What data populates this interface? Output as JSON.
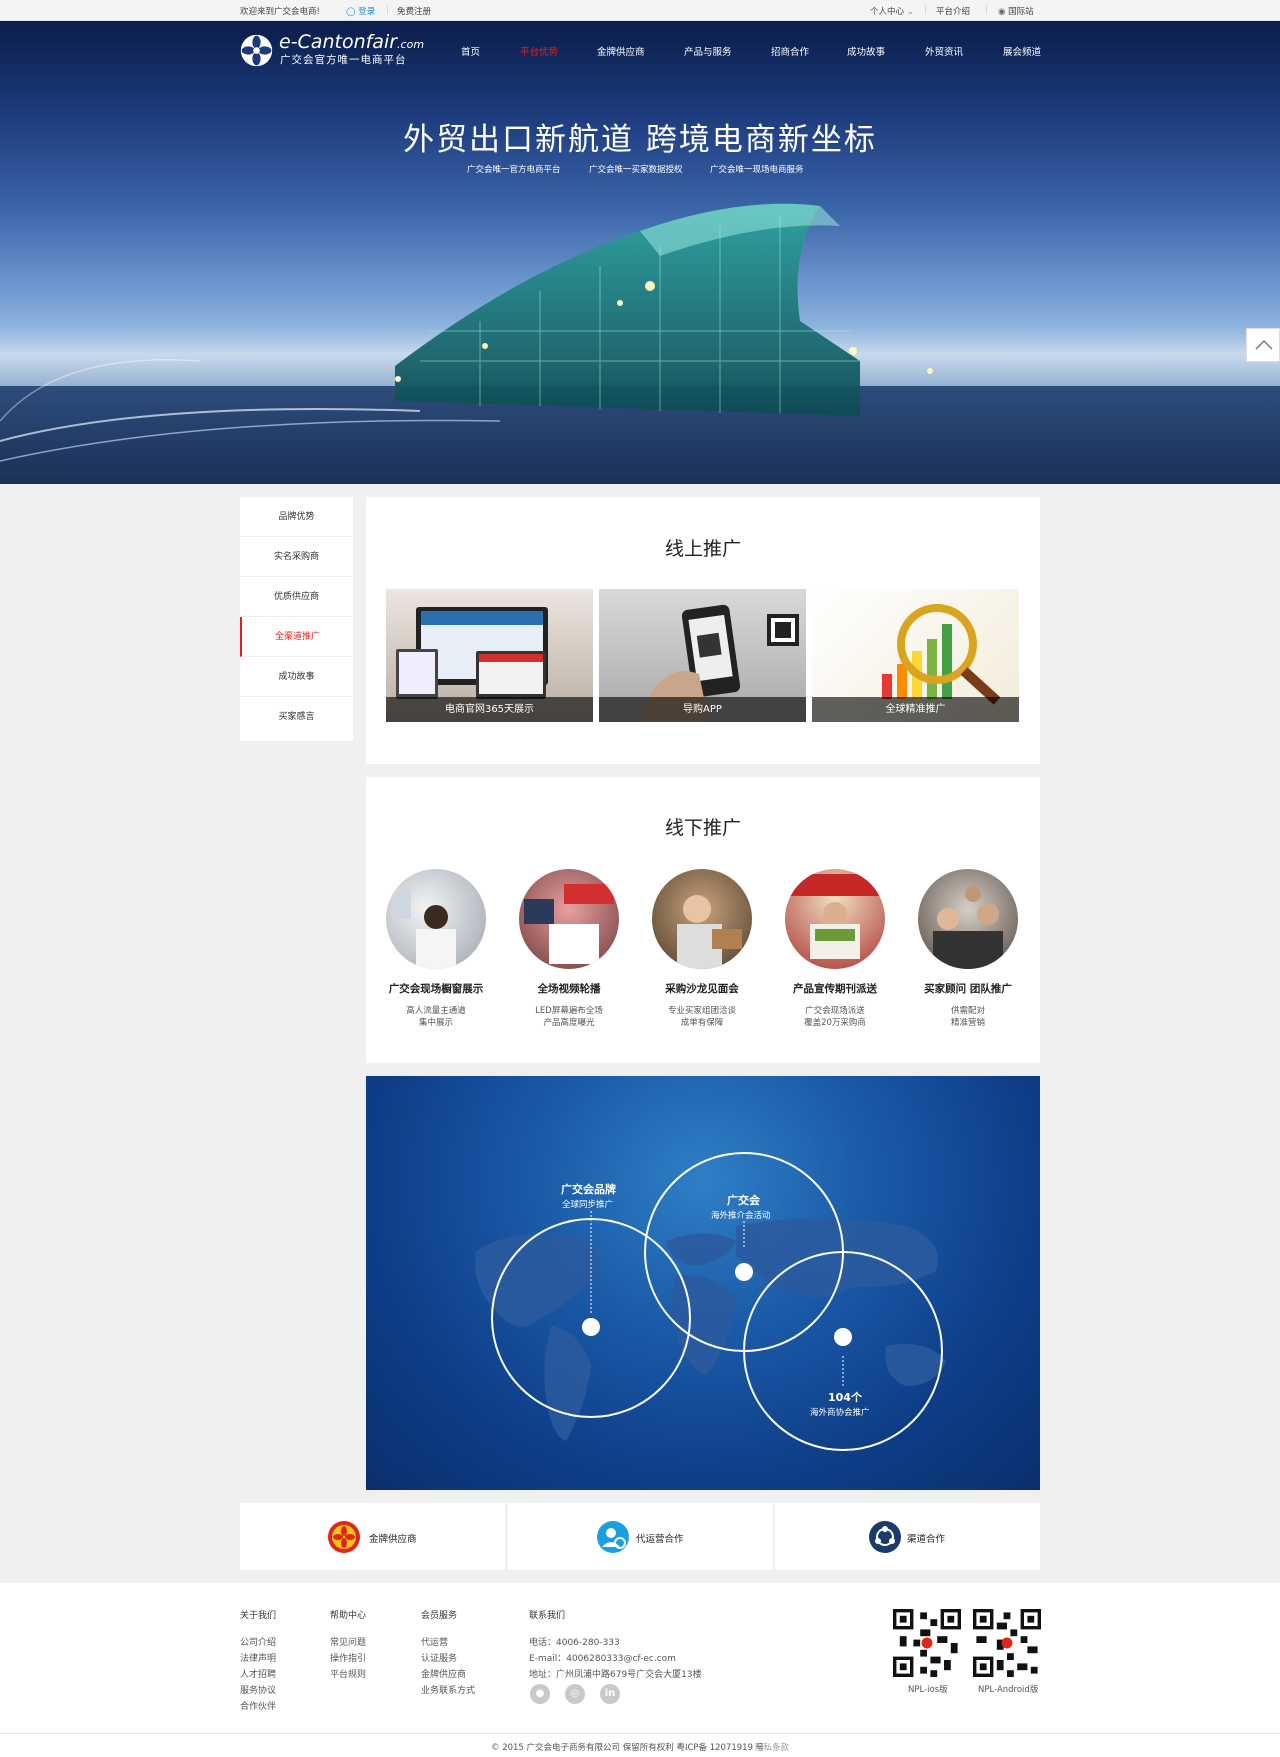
{
  "topbar": {
    "welcome": "欢迎来到广交会电商!",
    "login": "登录",
    "register": "免费注册",
    "user_center": "个人中心",
    "platform_intro": "平台介绍",
    "international": "国际站"
  },
  "header": {
    "logo_text": "e-Cantonfair",
    "logo_domain": ".com",
    "logo_sub": "广交会官方唯一电商平台",
    "nav": [
      "首页",
      "平台优势",
      "金牌供应商",
      "产品与服务",
      "招商合作",
      "成功故事",
      "外贸资讯",
      "展会频道"
    ],
    "active_nav": "平台优势"
  },
  "hero": {
    "title": "外贸出口新航道  跨境电商新坐标",
    "subs": [
      "广交会唯一官方电商平台",
      "广交会唯一买家数据授权",
      "广交会唯一现场电商服务"
    ]
  },
  "sidebar": {
    "items": [
      "品牌优势",
      "实名采购商",
      "优质供应商",
      "全渠道推广",
      "成功故事",
      "买家感言"
    ],
    "active": "全渠道推广"
  },
  "online": {
    "title": "线上推广",
    "cards": [
      "电商官网365天展示",
      "导购APP",
      "全球精准推广"
    ]
  },
  "offline": {
    "title": "线下推广",
    "items": [
      {
        "title": "广交会现场橱窗展示",
        "d1": "高人流量主通道",
        "d2": "集中展示"
      },
      {
        "title": "全场视频轮播",
        "d1": "LED屏幕遍布全场",
        "d2": "产品高度曝光"
      },
      {
        "title": "采购沙龙见面会",
        "d1": "专业买家组团洽谈",
        "d2": "成单有保障"
      },
      {
        "title": "产品宣传期刊派送",
        "d1": "广交会现场派送",
        "d2": "覆盖20万采购商"
      },
      {
        "title": "买家顾问 团队推广",
        "d1": "供需配对",
        "d2": "精准营销"
      }
    ]
  },
  "map": {
    "brand_t1": "广交会品牌",
    "brand_t2": "全球同步推广",
    "fair_t1": "广交会",
    "fair_t2": "海外推介会活动",
    "assoc_t1": "104个",
    "assoc_t2": "海外商协会推广"
  },
  "bottom_links": [
    "金牌供应商",
    "代运营合作",
    "渠道合作"
  ],
  "footer": {
    "col1_title": "关于我们",
    "col1": [
      "公司介绍",
      "法律声明",
      "人才招聘",
      "服务协议",
      "合作伙伴"
    ],
    "col2_title": "帮助中心",
    "col2": [
      "常见问题",
      "操作指引",
      "平台规则"
    ],
    "col3_title": "会员服务",
    "col3": [
      "代运营",
      "认证服务",
      "金牌供应商",
      "业务联系方式"
    ],
    "contact_title": "联系我们",
    "phone": "电话：4006-280-333",
    "email": "E-mail：4006280333@cf-ec.com",
    "address": "地址：广州凤浦中路679号广交会大厦13楼",
    "qr1": "NPL-ios版",
    "qr2": "NPL-Android版",
    "copyright": "© 2015 广交会电子商务有限公司 保留所有权利 粤ICP备 12071919 号",
    "privacy": "隐私条款"
  },
  "colors": {
    "accent_red": "#e02020",
    "map_blue": "#0e3d86",
    "icon_blue": "#1aa0e0",
    "icon_navy": "#1d3a6e"
  }
}
